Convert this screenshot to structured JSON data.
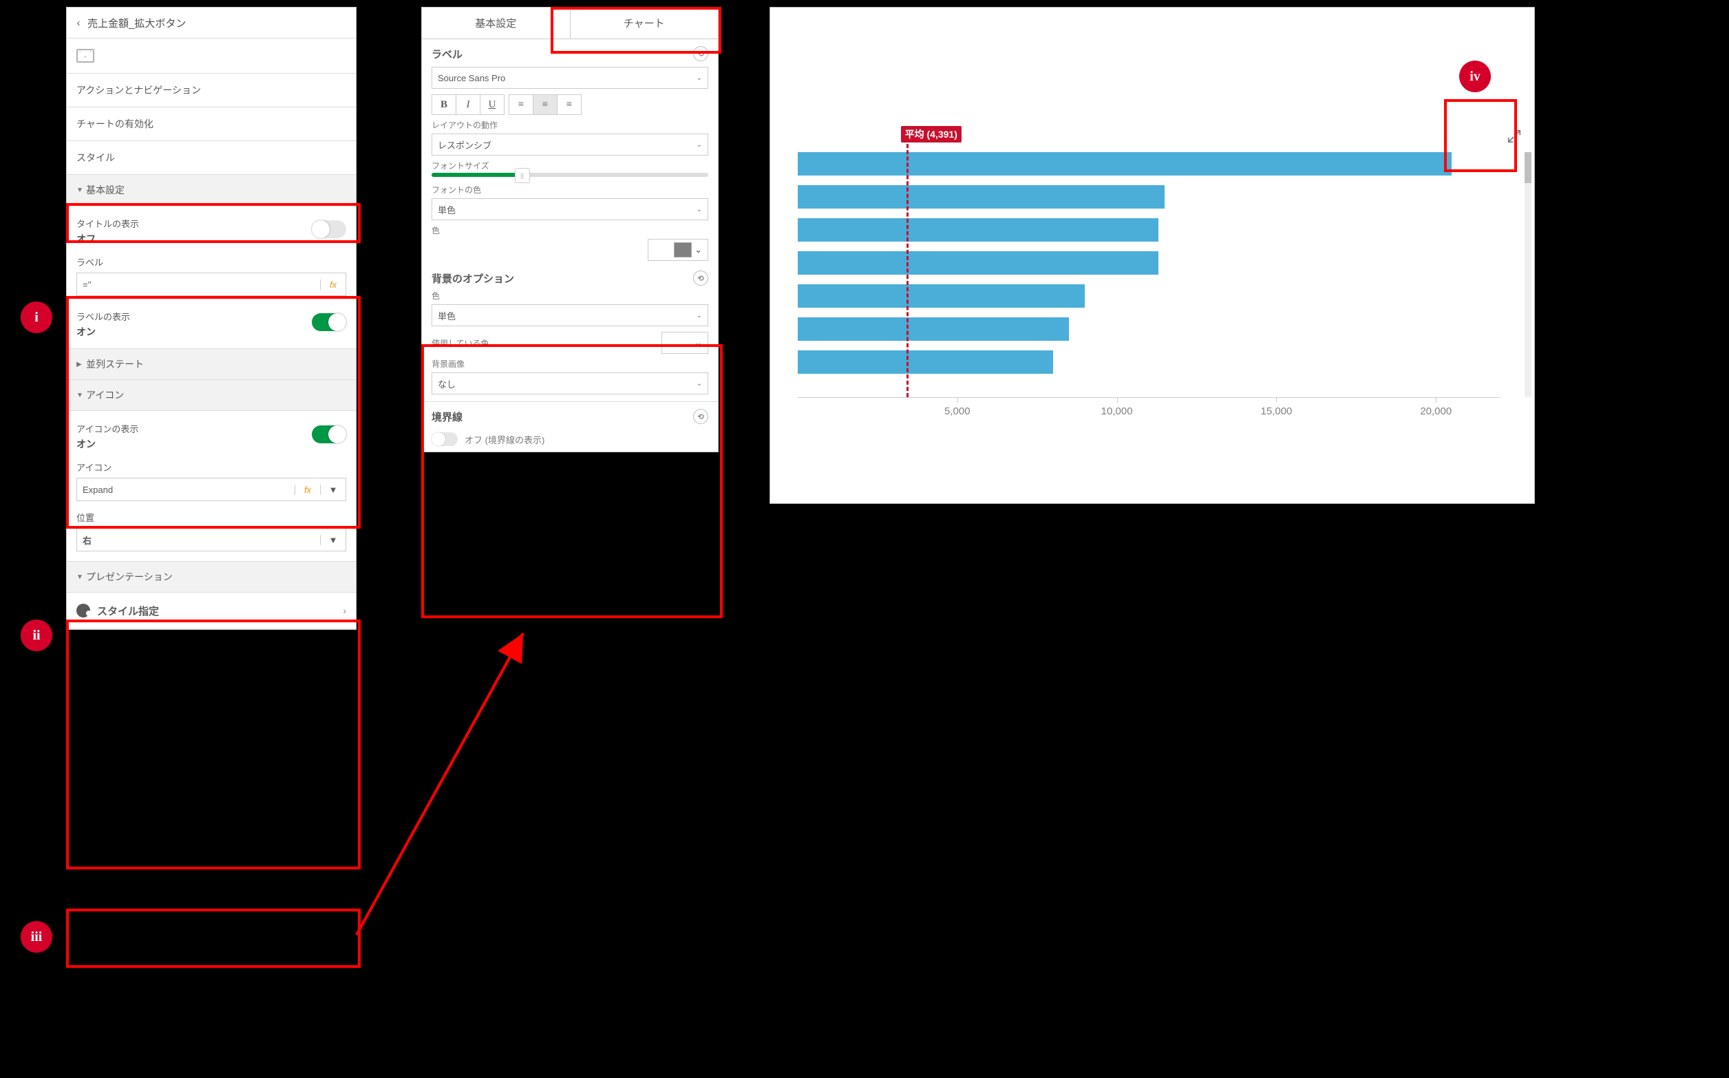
{
  "panel1": {
    "title": "売上金額_拡大ボタン",
    "items": {
      "actions_nav": "アクションとナビゲーション",
      "enable_chart": "チャートの有効化",
      "style": "スタイル"
    },
    "sect_basic": "基本設定",
    "basic": {
      "show_title_label": "タイトルの表示",
      "show_title_value": "オフ",
      "label_label": "ラベル",
      "label_value": "=''",
      "show_label_label": "ラベルの表示",
      "show_label_value": "オン"
    },
    "sect_parallel": "並列ステート",
    "sect_icon": "アイコン",
    "icon": {
      "show_icon_label": "アイコンの表示",
      "show_icon_value": "オン",
      "icon_label": "アイコン",
      "icon_value": "Expand",
      "position_label": "位置",
      "position_value": "右"
    },
    "sect_presentation": "プレゼンテーション",
    "style_row": "スタイル指定"
  },
  "panel2": {
    "tab_basic": "基本設定",
    "tab_chart": "チャート",
    "label_sect": "ラベル",
    "font_family": "Source Sans Pro",
    "layout_behavior_label": "レイアウトの動作",
    "layout_behavior_value": "レスポンシブ",
    "font_size_label": "フォントサイズ",
    "font_color_label": "フォントの色",
    "color_mode_single": "単色",
    "color_label_short": "色",
    "bg_options": "背景のオプション",
    "used_color": "使用している色",
    "bg_image_label": "背景画像",
    "bg_image_value": "なし",
    "border_sect": "境界線",
    "border_toggle_label": "オフ (境界線の表示)"
  },
  "callouts": {
    "i": "i",
    "ii": "ii",
    "iii": "iii",
    "iv": "iv"
  },
  "chart_data": {
    "type": "bar",
    "orientation": "horizontal",
    "series_color": "#4aaed9",
    "x_ticks": [
      5000,
      10000,
      15000,
      20000
    ],
    "x_tick_labels": [
      "5,000",
      "10,000",
      "15,000",
      "20,000"
    ],
    "x_range": [
      0,
      22000
    ],
    "values": [
      20500,
      11500,
      11300,
      11300,
      9000,
      8500,
      8000
    ],
    "average": {
      "label": "平均 (4,391)",
      "value": 4391,
      "line_x_approx": 3400
    }
  }
}
